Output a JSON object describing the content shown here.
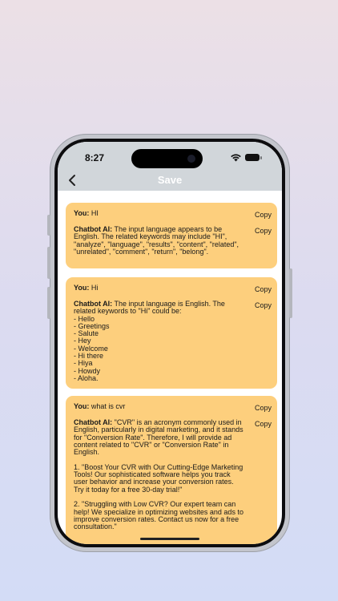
{
  "status_bar": {
    "time": "8:27"
  },
  "header": {
    "title": "Save"
  },
  "labels": {
    "you": "You:",
    "bot": "Chatbot AI:",
    "copy": "Copy"
  },
  "messages": [
    {
      "user": "HI",
      "bot": "The input language appears to be English. The related keywords may include \"HI\", \"analyze\", \"language\", \"results\", \"content\", \"related\", \"unrelated\", \"comment\", \"return\", \"belong\"."
    },
    {
      "user": "Hi",
      "bot": "The input language is English. The related keywords to \"Hi\" could be:\n- Hello\n- Greetings\n- Salute\n- Hey\n- Welcome\n- Hi there\n- Hiya\n- Howdy\n- Aloha."
    },
    {
      "user": "what is cvr",
      "bot": "\"CVR\" is an acronym commonly used in English, particularly in digital marketing, and it stands for \"Conversion Rate\". Therefore, I will provide ad content related to \"CVR\" or \"Conversion Rate\" in English.\n\n1. \"Boost Your CVR with Our Cutting-Edge Marketing Tools! Our sophisticated software helps you track user behavior and increase your conversion rates. Try it today for a free 30-day trial!\"\n\n2. \"Struggling with Low CVR? Our expert team can help! We specialize in optimizing websites and ads to improve conversion rates. Contact us now for a free consultation.\""
    }
  ],
  "colors": {
    "card": "#fdcf7d",
    "header": "#d1d6da"
  },
  "icons": {
    "back": "chevron-left-icon",
    "wifi": "wifi-icon",
    "battery": "battery-icon"
  }
}
